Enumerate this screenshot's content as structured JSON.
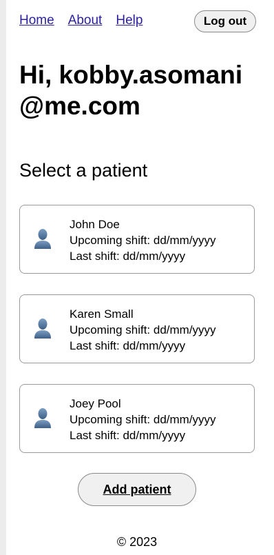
{
  "nav": {
    "home_label": "Home",
    "about_label": "About",
    "help_label": "Help",
    "logout_label": "Log out"
  },
  "greeting": "Hi, kobby.asomani@me.com",
  "subtitle": "Select a patient",
  "patients": [
    {
      "name": "John Doe",
      "upcoming_shift": "Upcoming shift: dd/mm/yyyy",
      "last_shift": "Last shift: dd/mm/yyyy"
    },
    {
      "name": "Karen Small",
      "upcoming_shift": "Upcoming shift: dd/mm/yyyy",
      "last_shift": "Last shift: dd/mm/yyyy"
    },
    {
      "name": "Joey Pool",
      "upcoming_shift": "Upcoming shift: dd/mm/yyyy",
      "last_shift": "Last shift: dd/mm/yyyy"
    }
  ],
  "add_patient_label": "Add patient",
  "footer": "© 2023",
  "icons": {
    "avatar": "person-icon"
  },
  "colors": {
    "link": "#2a1fa0",
    "avatar": "#4d6f94"
  }
}
